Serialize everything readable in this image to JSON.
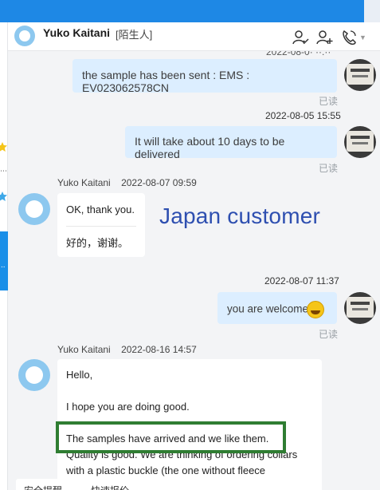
{
  "header": {
    "contact_name": "Yuko Kaitani",
    "contact_tag": "[陌生人]",
    "icons": [
      "add-user-icon",
      "add-contact-icon",
      "call-icon",
      "chevron-down-icon",
      "more-icon"
    ]
  },
  "annotation": "Japan customer",
  "messages": {
    "m1": {
      "text": "the sample has been sent : EMS : EV023062578CN",
      "status": "已读"
    },
    "m2": {
      "timestamp": "2022-08-05 15:55",
      "text": "It will take about 10 days to be delivered",
      "status": "已读"
    },
    "m3": {
      "sender": "Yuko Kaitani",
      "timestamp": "2022-08-07 09:59",
      "line1": "OK, thank you.",
      "line2": "好的，谢谢。"
    },
    "m4": {
      "timestamp": "2022-08-07 11:37",
      "text": "you are welcome",
      "status": "已读"
    },
    "m5": {
      "sender": "Yuko Kaitani",
      "timestamp": "2022-08-16 14:57",
      "p1": "Hello,",
      "p2": "I hope you are doing good.",
      "p3": "The samples have arrived and we like them.",
      "p4a": "Quality is good. We are thinking of ordering collars",
      "p4b": "with a plastic buckle (the one without fleece"
    }
  },
  "bottom_tabs": [
    "安全提醒",
    "快速报价"
  ],
  "colors": {
    "accent": "#1e88e5",
    "outgoing_bubble": "#dceeff",
    "annotation_text": "#2e4fb0",
    "highlight_box": "#2f7d32"
  }
}
